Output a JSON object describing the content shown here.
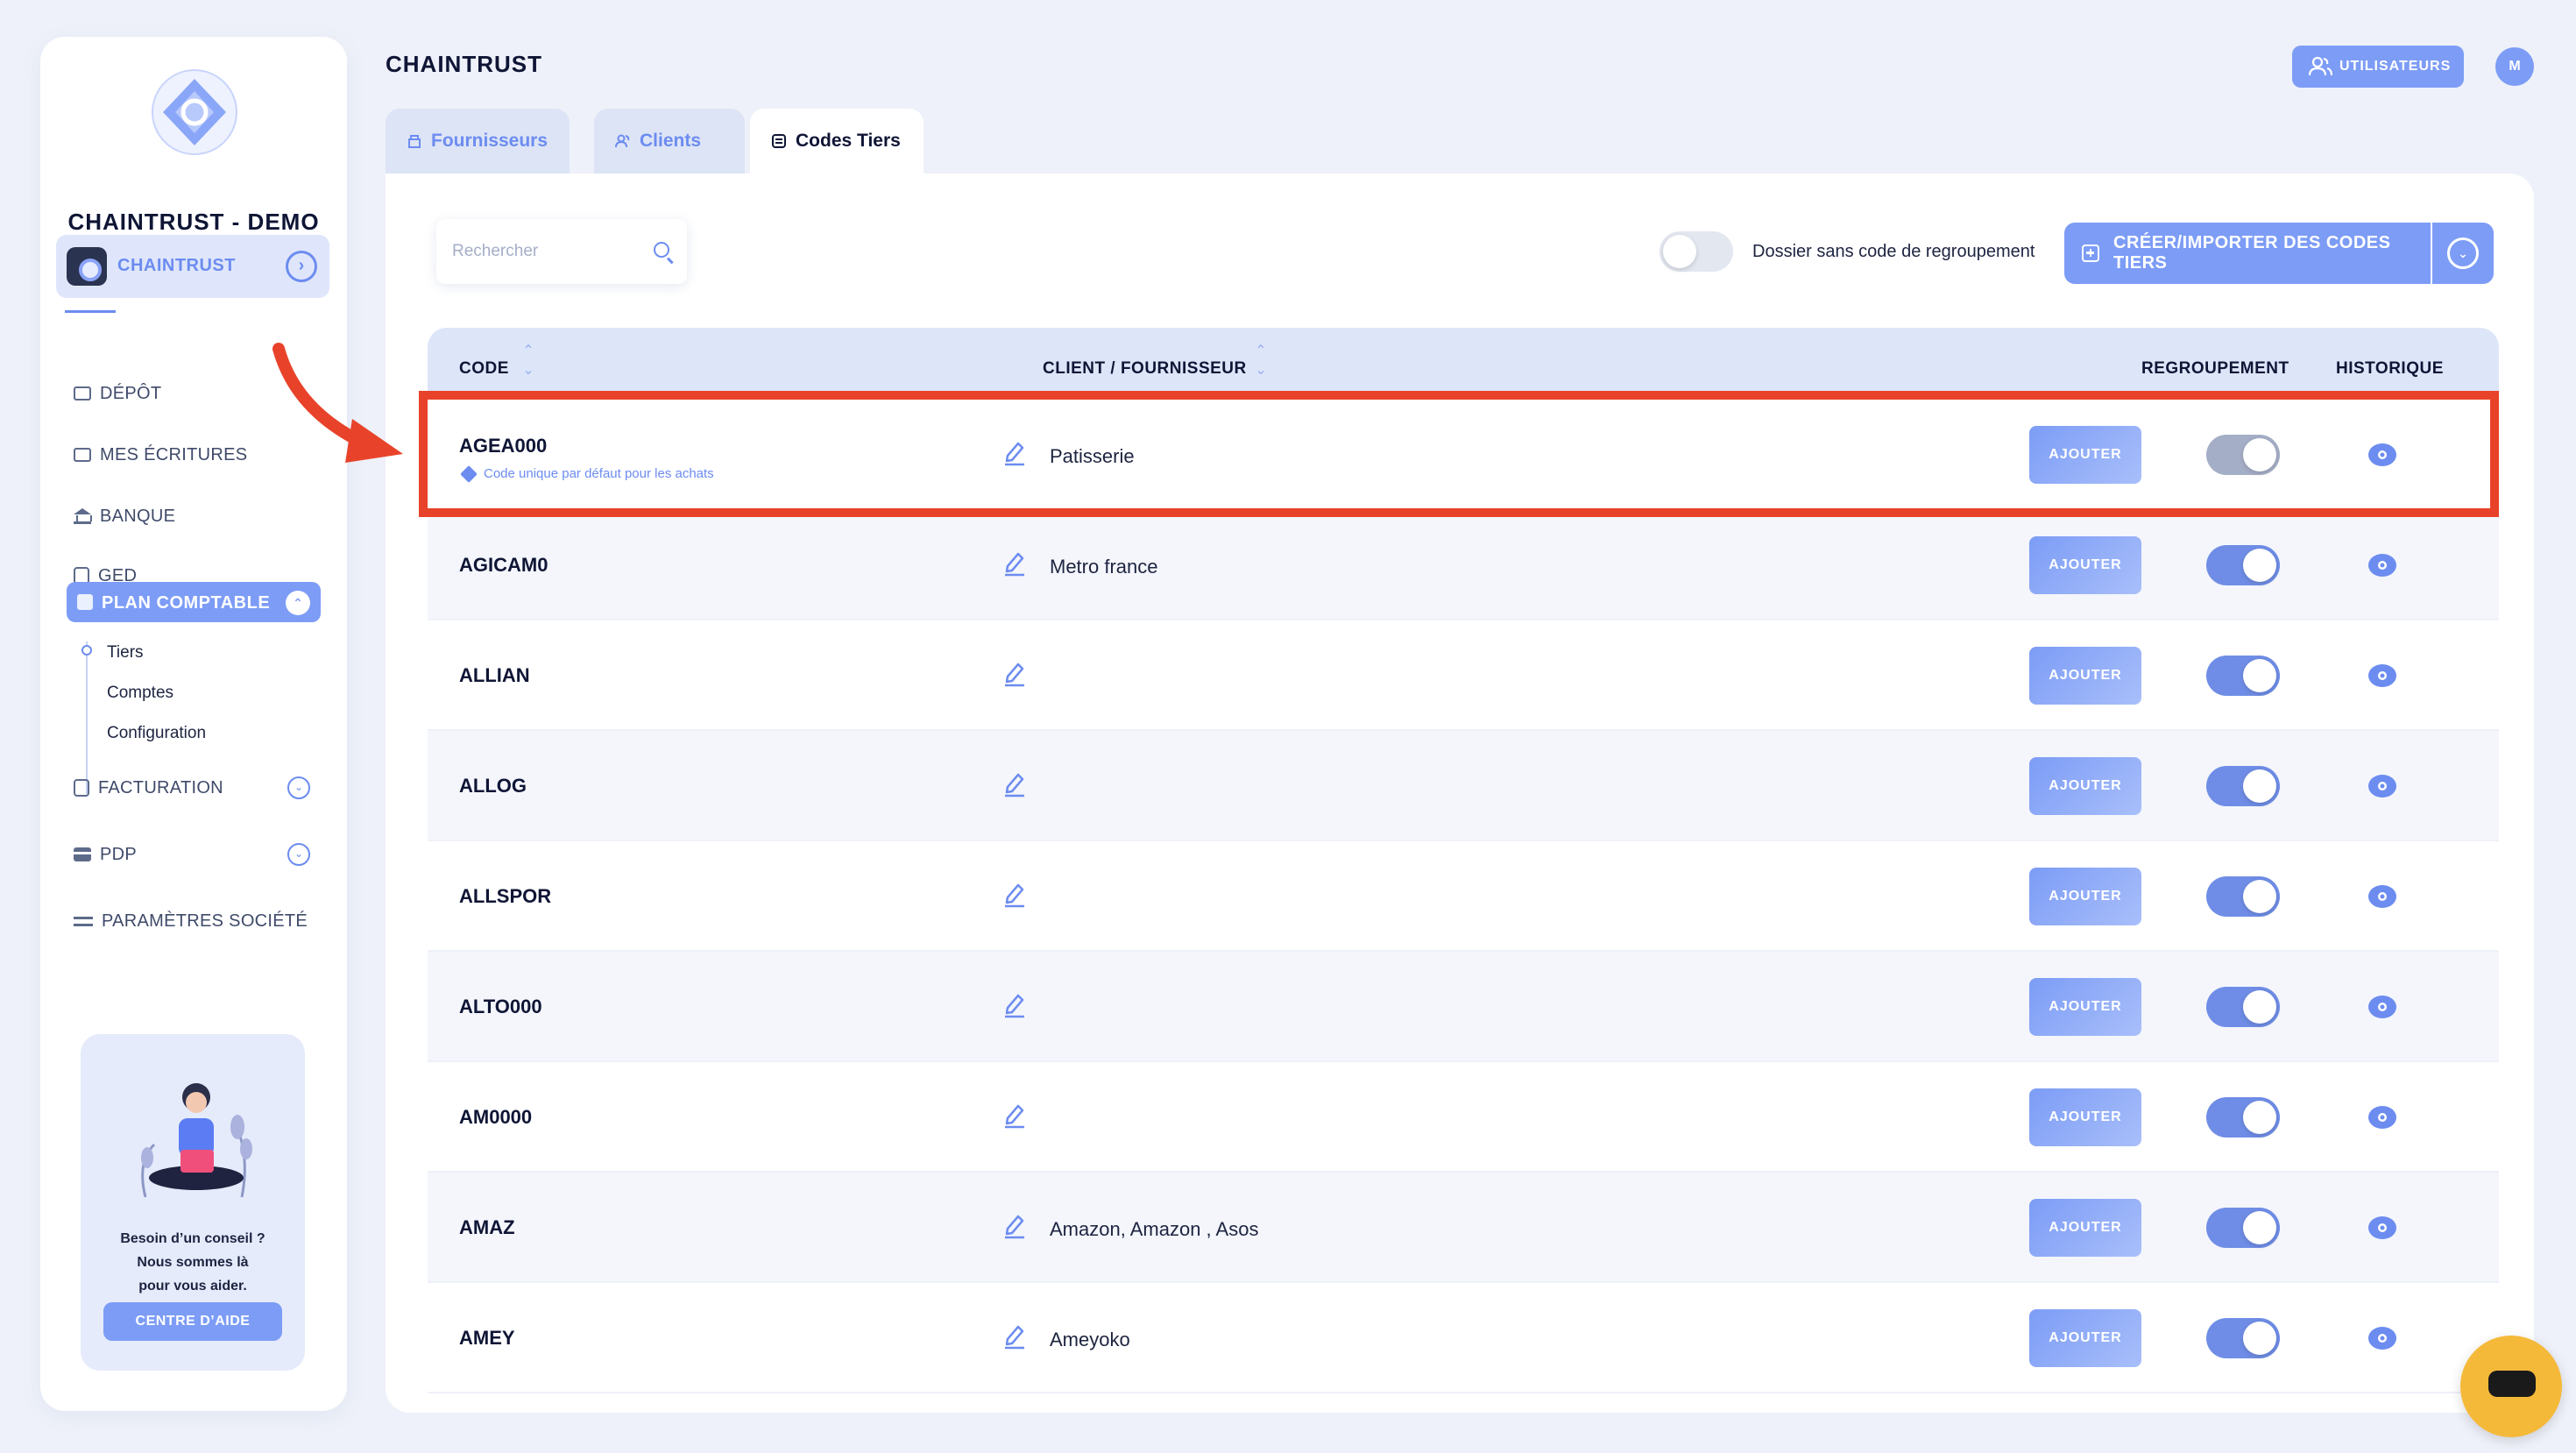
{
  "sidebar": {
    "brand": "CHAINTRUST - DEMO",
    "company": {
      "label": "CHAINTRUST"
    },
    "nav": {
      "depot": "DÉPÔT",
      "ecritures": "MES ÉCRITURES",
      "banque": "BANQUE",
      "ged": "GED",
      "plan": "PLAN COMPTABLE",
      "facturation": "FACTURATION",
      "pdp": "PDP",
      "parametres": "PARAMÈTRES SOCIÉTÉ"
    },
    "sub": {
      "tiers": "Tiers",
      "comptes": "Comptes",
      "configuration": "Configuration"
    },
    "help": {
      "line1": "Besoin d’un conseil ?",
      "line2": "Nous sommes là",
      "line3": "pour vous aider.",
      "button": "CENTRE D’AIDE"
    }
  },
  "header": {
    "title": "CHAINTRUST",
    "users_button": "UTILISATEURS",
    "avatar_initial": "M"
  },
  "tabs": [
    {
      "label": "Fournisseurs"
    },
    {
      "label": "Clients"
    },
    {
      "label": "Codes Tiers"
    }
  ],
  "toolbar": {
    "search_placeholder": "Rechercher",
    "toggle_label": "Dossier sans code de regroupement",
    "create_button": "CRÉER/IMPORTER DES CODES TIERS"
  },
  "table": {
    "headers": {
      "code": "CODE",
      "client": "CLIENT / FOURNISSEUR",
      "regroupement": "REGROUPEMENT",
      "historique": "HISTORIQUE"
    },
    "add_label": "AJOUTER",
    "rows": [
      {
        "code": "AGEA000",
        "sub": "Code unique par défaut pour les achats",
        "client": "Patisserie",
        "regroupement": false
      },
      {
        "code": "AGICAM0",
        "client": "Metro france",
        "regroupement": true
      },
      {
        "code": "ALLIAN",
        "client": "",
        "regroupement": true
      },
      {
        "code": "ALLOG",
        "client": "",
        "regroupement": true
      },
      {
        "code": "ALLSPOR",
        "client": "",
        "regroupement": true
      },
      {
        "code": "ALTO000",
        "client": "",
        "regroupement": true
      },
      {
        "code": "AM0000",
        "client": "",
        "regroupement": true
      },
      {
        "code": "AMAZ",
        "client": "Amazon, Amazon , Asos",
        "regroupement": true
      },
      {
        "code": "AMEY",
        "client": "Ameyoko",
        "regroupement": true
      }
    ]
  },
  "colors": {
    "accent": "#7c9cf6",
    "highlight": "#e8432a",
    "chat_bubble": "#f5b93a"
  }
}
